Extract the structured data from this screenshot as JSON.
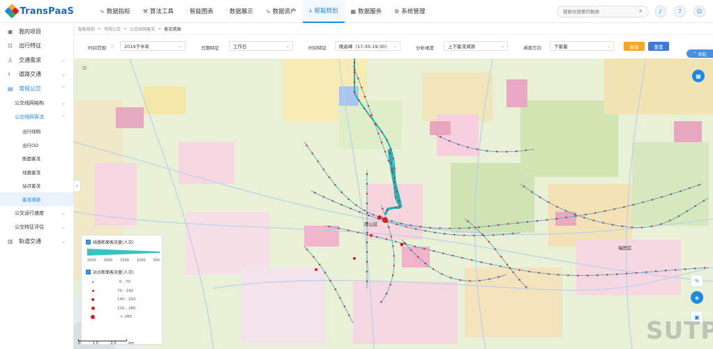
{
  "app": {
    "brand": "TransPaaS"
  },
  "nav": [
    {
      "label": "数据指标",
      "icon": "chart-line-icon"
    },
    {
      "label": "算法工具",
      "icon": "tools-icon"
    },
    {
      "label": "智能图表",
      "icon": "bar-chart-icon"
    },
    {
      "label": "数据展示",
      "icon": "bar-chart-icon"
    },
    {
      "label": "数据资产",
      "icon": "chart-line-icon"
    },
    {
      "label": "智能规划",
      "icon": "plan-icon",
      "active": true
    },
    {
      "label": "数据服务",
      "icon": "grid-icon"
    },
    {
      "label": "系统管理",
      "icon": "gear-icon"
    }
  ],
  "search": {
    "placeholder": "搜索你想要的数据"
  },
  "sidebar": {
    "items": [
      {
        "label": "我的项目",
        "icon": "project-icon"
      },
      {
        "label": "出行特征",
        "icon": "travel-icon"
      },
      {
        "label": "交通需求",
        "icon": "demand-icon",
        "chevron": "⌄"
      },
      {
        "label": "道路交通",
        "icon": "road-icon",
        "chevron": "⌄"
      },
      {
        "label": "常规公交",
        "icon": "bus-icon",
        "chevron": "⌃",
        "open": true
      }
    ],
    "sub_a": {
      "label": "公交线网结构",
      "chevron": "⌄"
    },
    "sub_b": {
      "label": "公交线网客流",
      "chevron": "⌃"
    },
    "leaves": [
      {
        "label": "出行线网"
      },
      {
        "label": "出行OD"
      },
      {
        "label": "断面客流"
      },
      {
        "label": "线路客流"
      },
      {
        "label": "站点客流"
      },
      {
        "label": "客流溯源",
        "active": true
      }
    ],
    "sub_c": {
      "label": "公交运行速度",
      "chevron": "⌄"
    },
    "sub_d": {
      "label": "公交特征评估",
      "chevron": "⌄"
    },
    "rail": {
      "label": "轨道交通",
      "icon": "rail-icon",
      "chevron": "⌄"
    }
  },
  "breadcrumb": [
    "智能规划",
    "常规公交",
    "公交线网客流",
    "客流溯源"
  ],
  "filters": {
    "time_range": {
      "label": "时间范围",
      "value": "2019下半年"
    },
    "date_feature": {
      "label": "日期特征",
      "value": "工作日"
    },
    "time_feature": {
      "label": "时间特征",
      "value": "晚高峰（17:30-19:30）"
    },
    "analysis_dim": {
      "label": "分析维度",
      "value": "上下客流溯源"
    },
    "trace_dir": {
      "label": "溯源方向",
      "value": "下客量"
    },
    "query_label": "查询",
    "reset_label": "重置",
    "collapse_label": "收起"
  },
  "map": {
    "labels": {
      "center": "南山区",
      "east": "福田区"
    },
    "scale": {
      "ticks": [
        "0",
        "1.0",
        "2.0"
      ],
      "unit": "km"
    },
    "watermark": "SUTPC"
  },
  "legend": {
    "line_title": "线路断面客流量(人次)",
    "line_scale": [
      "2500",
      "2000",
      "1500",
      "1000",
      "500"
    ],
    "stop_title": "站点断面客流量(人次)",
    "stop_rows": [
      "0 - 70",
      "70 - 140",
      "140 - 210",
      "210 - 280",
      "> 280"
    ]
  },
  "colors": {
    "accent": "#1e88e5",
    "flow": "#19b5b8",
    "stop": "#e8161c",
    "query": "#f5a623",
    "reset": "#3a7bd5"
  }
}
